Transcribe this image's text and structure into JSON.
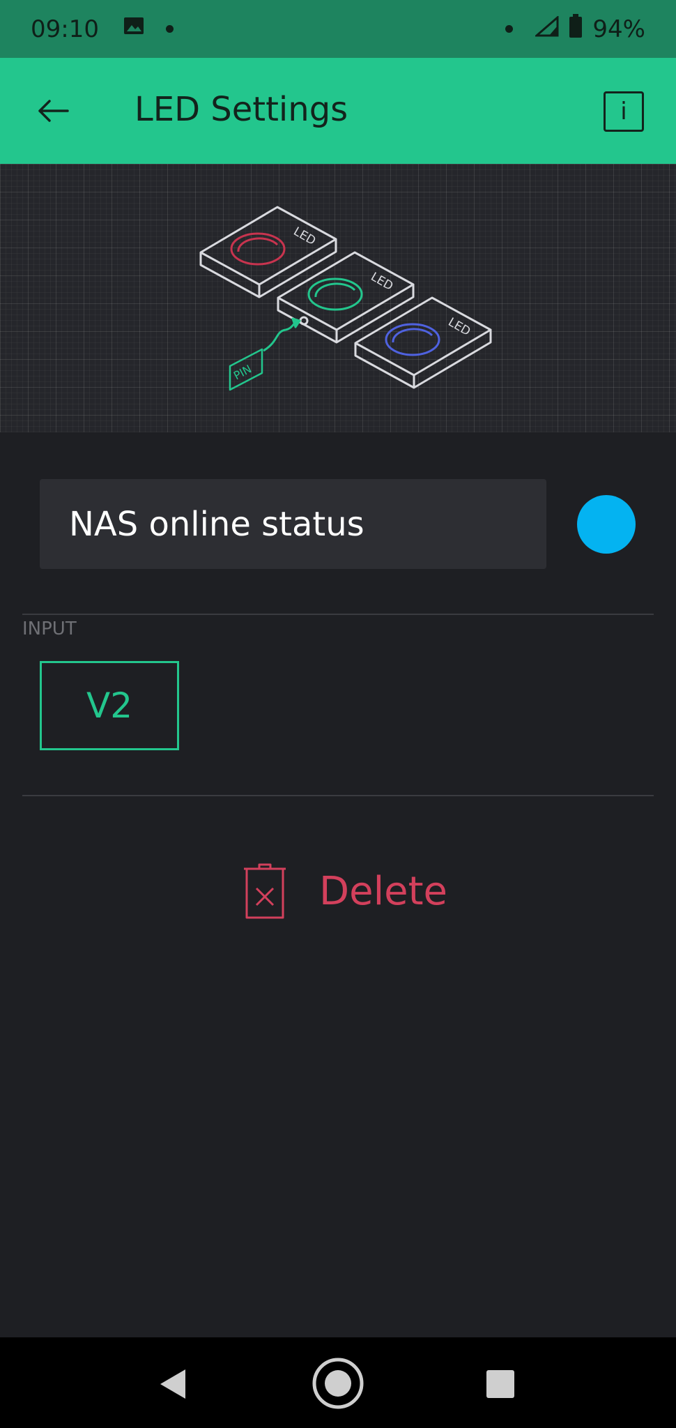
{
  "status_bar": {
    "time": "09:10",
    "battery": "94%",
    "icons": [
      "image-icon",
      "notification-dot-icon",
      "notification-dot-icon",
      "signal-icon",
      "battery-icon"
    ]
  },
  "app_bar": {
    "title": "LED Settings",
    "back_icon": "arrow-left-icon",
    "info_label": "i"
  },
  "hero": {
    "led_label": "LED",
    "pin_label": "PIN",
    "led_colors": [
      "#c8344f",
      "#23c68d",
      "#4f62e0"
    ]
  },
  "widget": {
    "name_value": "NAS online status",
    "color": "#04b3f1"
  },
  "input": {
    "section_label": "INPUT",
    "pin_value": "V2"
  },
  "delete": {
    "label": "Delete",
    "icon": "trash-icon"
  },
  "nav": {
    "icons": [
      "back-triangle-icon",
      "home-circle-icon",
      "recents-square-icon"
    ]
  },
  "colors": {
    "accent": "#23c68d",
    "status_bar": "#1e845f",
    "danger": "#d3405c",
    "background": "#1e1f23"
  }
}
